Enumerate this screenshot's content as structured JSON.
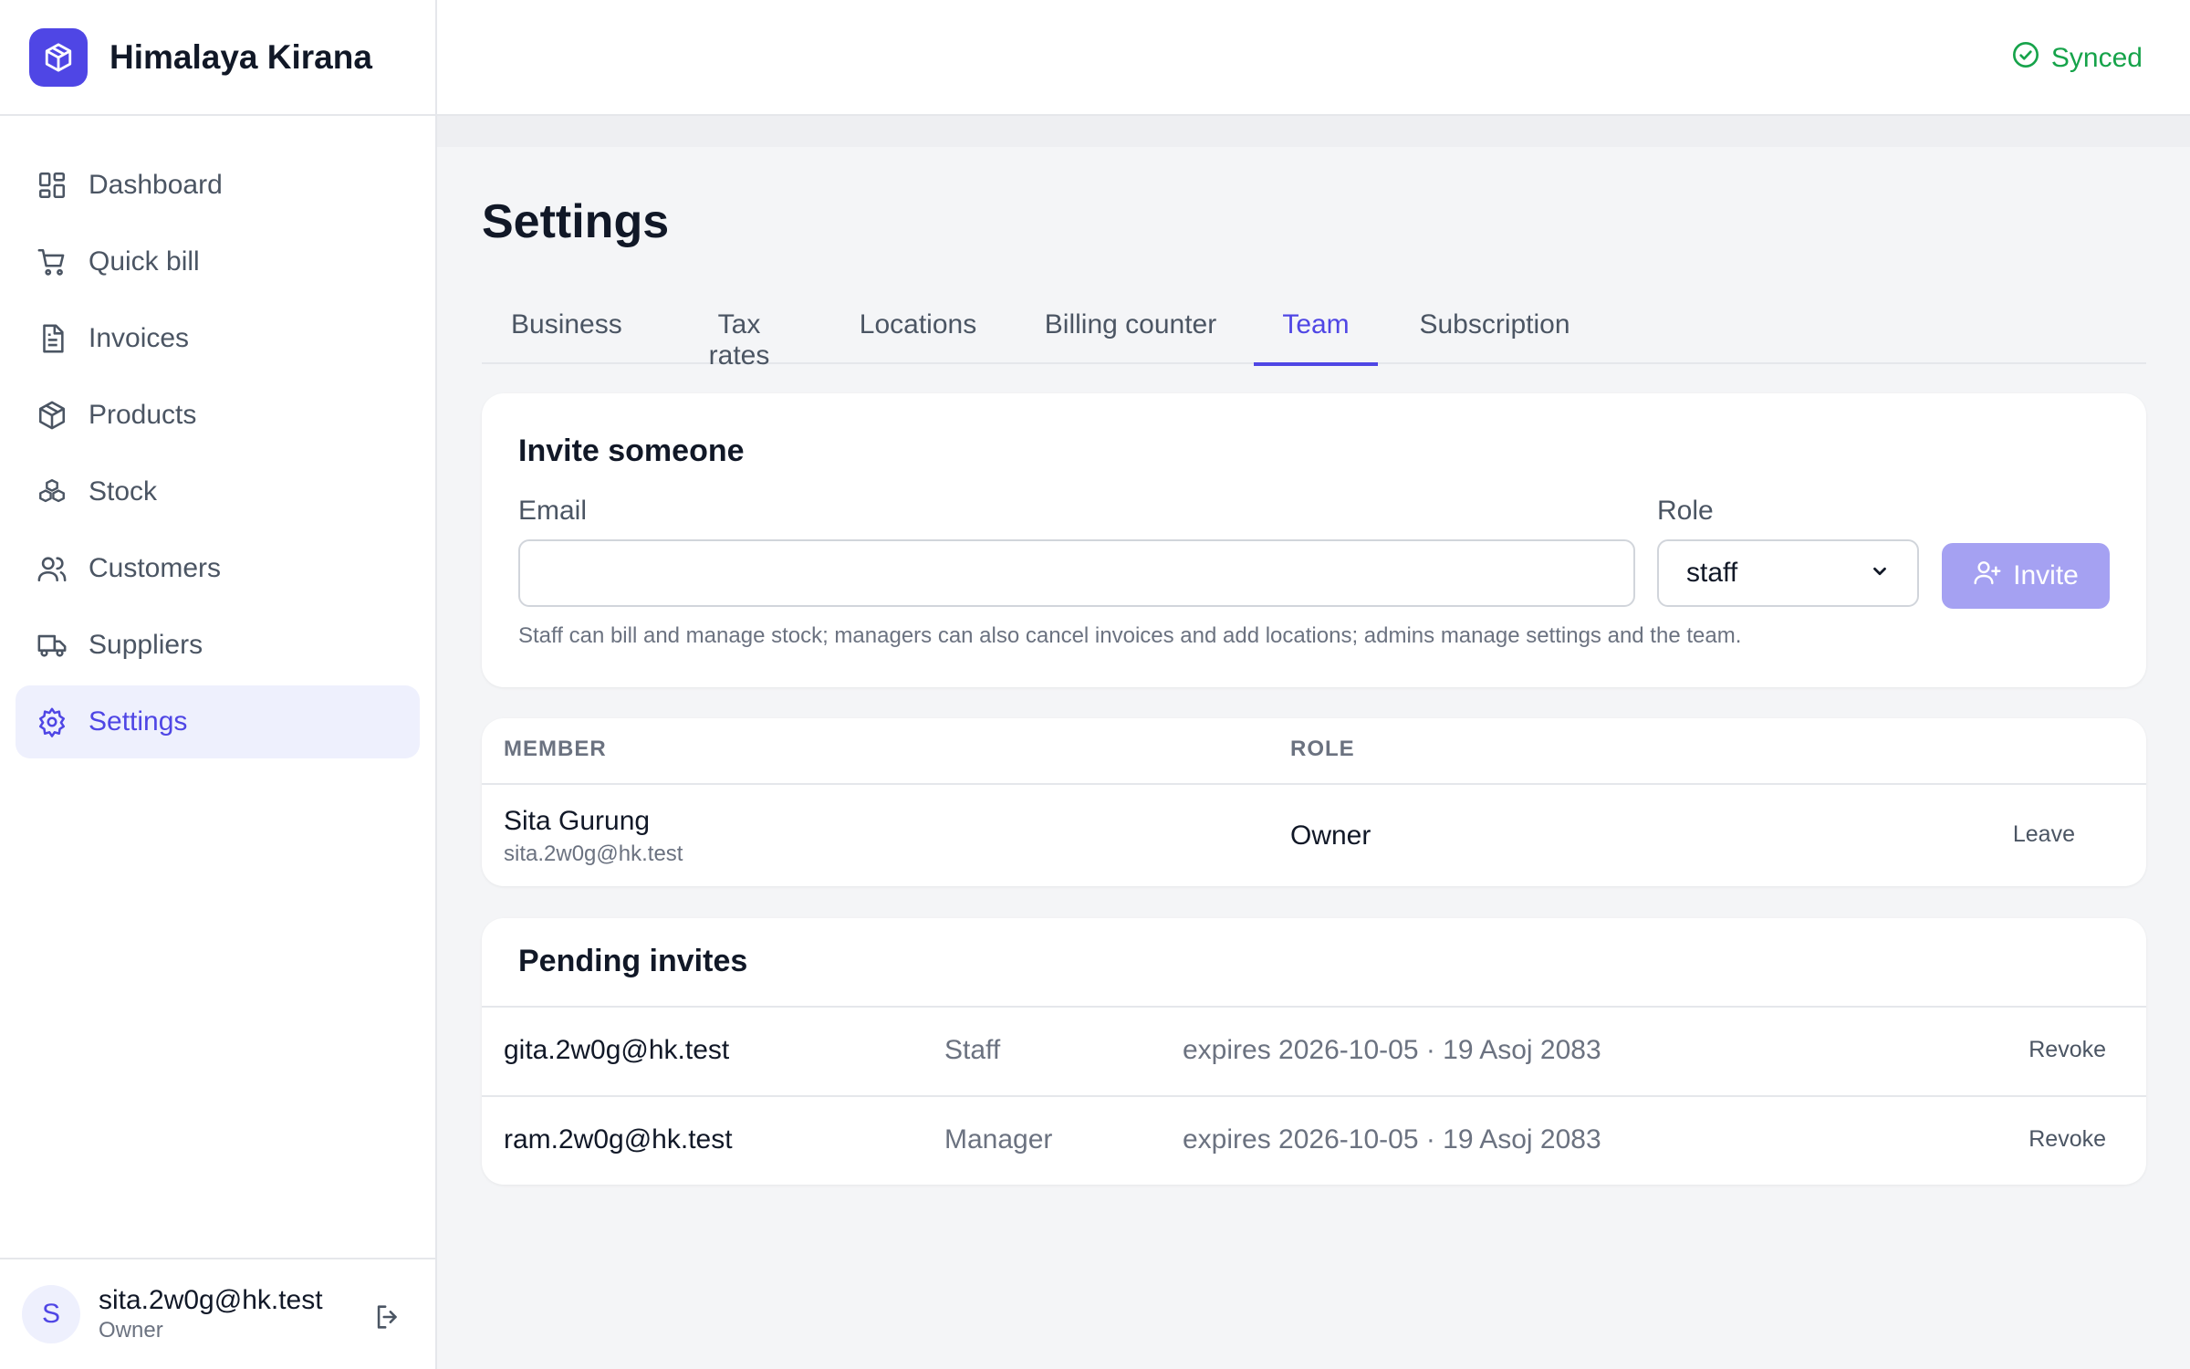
{
  "app": {
    "name": "Himalaya Kirana",
    "logo_icon": "box-icon",
    "accent": "#4f46e5"
  },
  "sidebar": {
    "items": [
      {
        "label": "Dashboard",
        "icon": "dashboard-icon"
      },
      {
        "label": "Quick bill",
        "icon": "cart-icon"
      },
      {
        "label": "Invoices",
        "icon": "document-icon"
      },
      {
        "label": "Products",
        "icon": "box-icon"
      },
      {
        "label": "Stock",
        "icon": "boxes-icon"
      },
      {
        "label": "Customers",
        "icon": "users-icon"
      },
      {
        "label": "Suppliers",
        "icon": "truck-icon"
      },
      {
        "label": "Settings",
        "icon": "gear-icon",
        "active": true
      }
    ]
  },
  "user": {
    "initial": "S",
    "email": "sita.2w0g@hk.test",
    "role": "Owner"
  },
  "header": {
    "sync_status": "Synced",
    "sync_color": "#16a34a"
  },
  "page": {
    "title": "Settings"
  },
  "tabs": [
    {
      "label": "Business"
    },
    {
      "label": "Tax rates"
    },
    {
      "label": "Locations"
    },
    {
      "label": "Billing counter"
    },
    {
      "label": "Team",
      "active": true
    },
    {
      "label": "Subscription"
    }
  ],
  "invite": {
    "title": "Invite someone",
    "email_label": "Email",
    "email_value": "",
    "role_label": "Role",
    "role_value": "staff",
    "button_label": "Invite",
    "hint": "Staff can bill and manage stock; managers can also cancel invoices and add locations; admins manage settings and the team."
  },
  "members": {
    "headers": {
      "member": "MEMBER",
      "role": "ROLE"
    },
    "rows": [
      {
        "name": "Sita Gurung",
        "email": "sita.2w0g@hk.test",
        "role": "Owner",
        "action": "Leave"
      }
    ]
  },
  "pending": {
    "title": "Pending invites",
    "rows": [
      {
        "email": "gita.2w0g@hk.test",
        "role": "Staff",
        "expires": "expires 2026-10-05 · 19 Asoj 2083",
        "action": "Revoke"
      },
      {
        "email": "ram.2w0g@hk.test",
        "role": "Manager",
        "expires": "expires 2026-10-05 · 19 Asoj 2083",
        "action": "Revoke"
      }
    ]
  }
}
